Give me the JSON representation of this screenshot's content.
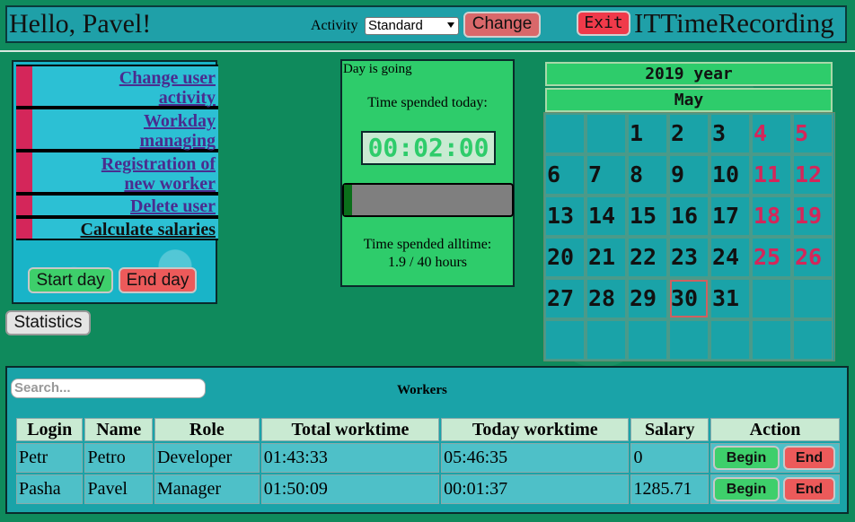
{
  "header": {
    "greeting": "Hello, Pavel!",
    "activity_label": "Activity",
    "activity_selected": "Standard",
    "change_label": "Change",
    "exit_label": "Exit",
    "app_title": "ITTimeRecording"
  },
  "menu": {
    "items": [
      {
        "line1": "Change user",
        "line2": "activity"
      },
      {
        "line1": "Workday",
        "line2": "managing"
      },
      {
        "line1": "Registration of",
        "line2": "new worker"
      },
      {
        "line1": "Delete user"
      },
      {
        "line1": "Calculate salaries"
      }
    ],
    "start_day_label": "Start day",
    "end_day_label": "End day",
    "statistics_label": "Statistics"
  },
  "timer": {
    "status": "Day is going",
    "spent_today_label": "Time spended today:",
    "time_display": "00:02:00",
    "spent_all_label": "Time spended alltime:",
    "spent_all_value": "1.9 / 40 hours",
    "progress_fraction": 0.0475
  },
  "calendar": {
    "year": "2019 year",
    "month": "May",
    "today": 30,
    "leading_blanks": 2,
    "days_in_month": 31,
    "weekend_color": "#d4265a"
  },
  "workers": {
    "search_placeholder": "Search...",
    "title": "Workers",
    "columns": [
      "Login",
      "Name",
      "Role",
      "Total worktime",
      "Today worktime",
      "Salary",
      "Action"
    ],
    "rows": [
      {
        "login": "Petr",
        "name": "Petro",
        "role": "Developer",
        "total": "01:43:33",
        "today": "05:46:35",
        "salary": "0"
      },
      {
        "login": "Pasha",
        "name": "Pavel",
        "role": "Manager",
        "total": "01:50:09",
        "today": "00:01:37",
        "salary": "1285.71"
      }
    ],
    "begin_label": "Begin",
    "end_label": "End"
  }
}
